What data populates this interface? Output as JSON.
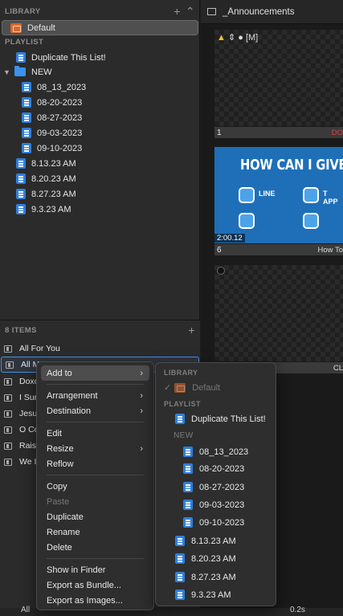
{
  "library": {
    "header": "LIBRARY",
    "add_icon": "plus-icon",
    "collapse_icon": "chevron-up-icon",
    "selected": "Default"
  },
  "playlist": {
    "header": "PLAYLIST",
    "items": [
      {
        "label": "Duplicate This List!",
        "type": "playlist"
      },
      {
        "label": "NEW",
        "type": "folder",
        "expanded": true
      },
      {
        "label": "08_13_2023",
        "type": "playlist",
        "indent": 1
      },
      {
        "label": "08-20-2023",
        "type": "playlist",
        "indent": 1
      },
      {
        "label": "08-27-2023",
        "type": "playlist",
        "indent": 1
      },
      {
        "label": "09-03-2023",
        "type": "playlist",
        "indent": 1
      },
      {
        "label": "09-10-2023",
        "type": "playlist",
        "indent": 1
      },
      {
        "label": "8.13.23 AM",
        "type": "playlist"
      },
      {
        "label": "8.20.23 AM",
        "type": "playlist"
      },
      {
        "label": "8.27.23 AM",
        "type": "playlist"
      },
      {
        "label": "9.3.23 AM",
        "type": "playlist"
      }
    ]
  },
  "items_pane": {
    "header": "8 ITEMS",
    "rows": [
      "All For You",
      "All M",
      "Doxo",
      "I Sur",
      "Jesu",
      "O Co",
      "Rais",
      "We I"
    ]
  },
  "right": {
    "title": "_Announcements",
    "toolbar_glyphs": "[M]",
    "slides": [
      {
        "number": "1",
        "right_label": "DO"
      },
      {
        "number": "6",
        "right_label": "How To",
        "time": "2:00.12",
        "title": "HOW CAN I GIVE",
        "texts": [
          "LINE",
          "T APP"
        ]
      }
    ],
    "third_label_right": "CL"
  },
  "context_menu": {
    "items": [
      {
        "label": "Add to",
        "submenu": true,
        "highlighted": true
      },
      {
        "label": "Arrangement",
        "submenu": true
      },
      {
        "label": "Destination",
        "submenu": true
      },
      {
        "label": "Edit"
      },
      {
        "label": "Resize",
        "submenu": true
      },
      {
        "label": "Reflow"
      },
      {
        "label": "Copy"
      },
      {
        "label": "Paste",
        "disabled": true
      },
      {
        "label": "Duplicate"
      },
      {
        "label": "Rename"
      },
      {
        "label": "Delete"
      },
      {
        "label": "Show in Finder"
      },
      {
        "label": "Export as Bundle..."
      },
      {
        "label": "Export as Images..."
      }
    ]
  },
  "submenu": {
    "library_header": "LIBRARY",
    "library_default": "Default",
    "playlist_header": "PLAYLIST",
    "new_header": "NEW",
    "items": [
      "Duplicate This List!",
      "08_13_2023",
      "08-20-2023",
      "08-27-2023",
      "09-03-2023",
      "09-10-2023",
      "8.13.23 AM",
      "8.20.23 AM",
      "8.27.23 AM",
      "9.3.23 AM"
    ]
  },
  "bottom": {
    "filter_label": "All",
    "duration": "0.2s"
  }
}
